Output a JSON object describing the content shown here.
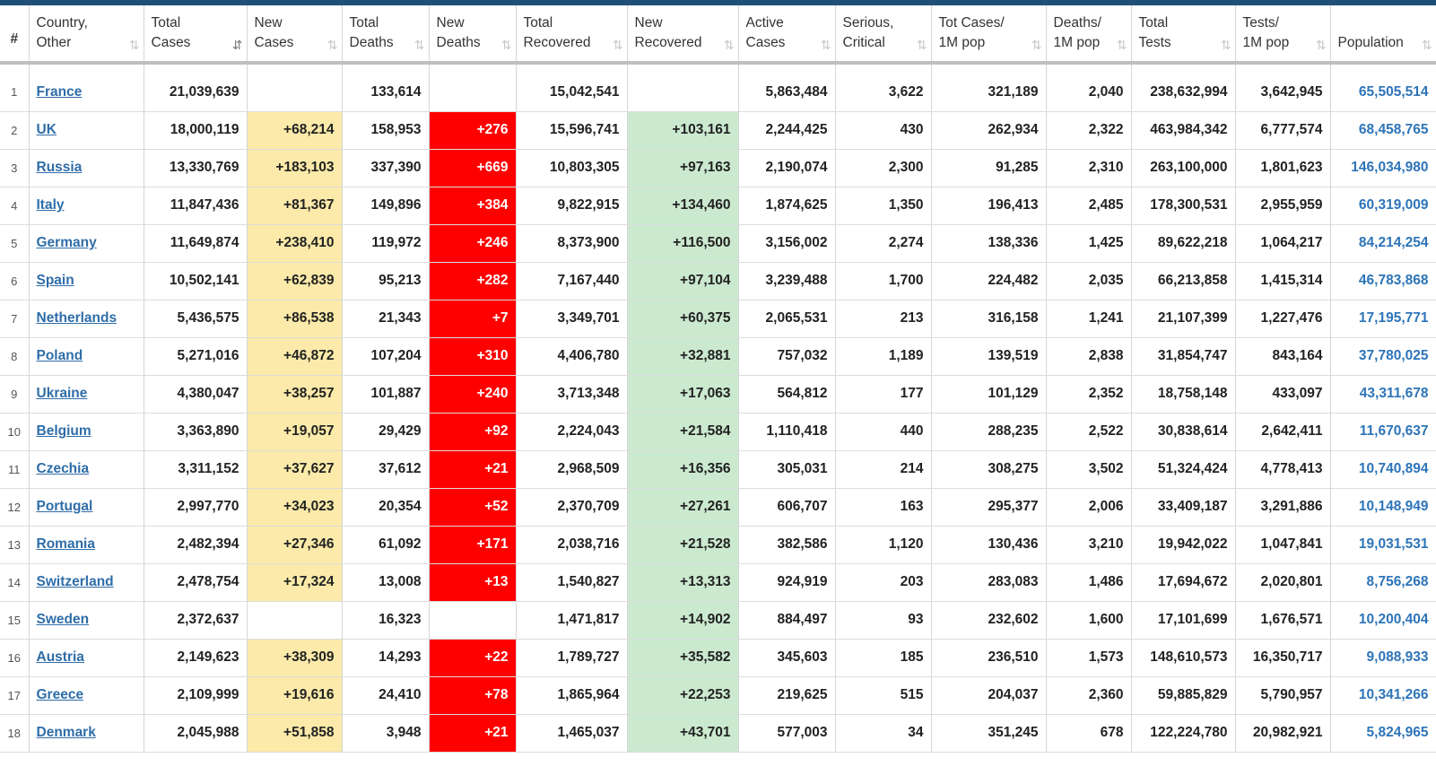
{
  "headers": [
    {
      "l1": "#",
      "l2": ""
    },
    {
      "l1": "Country,",
      "l2": "Other"
    },
    {
      "l1": "Total",
      "l2": "Cases"
    },
    {
      "l1": "New",
      "l2": "Cases"
    },
    {
      "l1": "Total",
      "l2": "Deaths"
    },
    {
      "l1": "New",
      "l2": "Deaths"
    },
    {
      "l1": "Total",
      "l2": "Recovered"
    },
    {
      "l1": "New",
      "l2": "Recovered"
    },
    {
      "l1": "Active",
      "l2": "Cases"
    },
    {
      "l1": "Serious,",
      "l2": "Critical"
    },
    {
      "l1": "Tot Cases/",
      "l2": "1M pop"
    },
    {
      "l1": "Deaths/",
      "l2": "1M pop"
    },
    {
      "l1": "Total",
      "l2": "Tests"
    },
    {
      "l1": "Tests/",
      "l2": "1M pop"
    },
    {
      "l1": "",
      "l2": "Population"
    }
  ],
  "sort_icon": "⇅",
  "active_sort_icon": "⇵",
  "colors": {
    "new_cases_bg": "#fbeaa9",
    "new_deaths_bg": "#ff0000",
    "new_recovered_bg": "#cbe9cf",
    "link": "#2f6da8",
    "population": "#2d74b8",
    "topbar": "#1f4e79"
  },
  "rows": [
    [
      "1",
      "France",
      "21,039,639",
      "",
      "133,614",
      "",
      "15,042,541",
      "",
      "5,863,484",
      "3,622",
      "321,189",
      "2,040",
      "238,632,994",
      "3,642,945",
      "65,505,514"
    ],
    [
      "2",
      "UK",
      "18,000,119",
      "+68,214",
      "158,953",
      "+276",
      "15,596,741",
      "+103,161",
      "2,244,425",
      "430",
      "262,934",
      "2,322",
      "463,984,342",
      "6,777,574",
      "68,458,765"
    ],
    [
      "3",
      "Russia",
      "13,330,769",
      "+183,103",
      "337,390",
      "+669",
      "10,803,305",
      "+97,163",
      "2,190,074",
      "2,300",
      "91,285",
      "2,310",
      "263,100,000",
      "1,801,623",
      "146,034,980"
    ],
    [
      "4",
      "Italy",
      "11,847,436",
      "+81,367",
      "149,896",
      "+384",
      "9,822,915",
      "+134,460",
      "1,874,625",
      "1,350",
      "196,413",
      "2,485",
      "178,300,531",
      "2,955,959",
      "60,319,009"
    ],
    [
      "5",
      "Germany",
      "11,649,874",
      "+238,410",
      "119,972",
      "+246",
      "8,373,900",
      "+116,500",
      "3,156,002",
      "2,274",
      "138,336",
      "1,425",
      "89,622,218",
      "1,064,217",
      "84,214,254"
    ],
    [
      "6",
      "Spain",
      "10,502,141",
      "+62,839",
      "95,213",
      "+282",
      "7,167,440",
      "+97,104",
      "3,239,488",
      "1,700",
      "224,482",
      "2,035",
      "66,213,858",
      "1,415,314",
      "46,783,868"
    ],
    [
      "7",
      "Netherlands",
      "5,436,575",
      "+86,538",
      "21,343",
      "+7",
      "3,349,701",
      "+60,375",
      "2,065,531",
      "213",
      "316,158",
      "1,241",
      "21,107,399",
      "1,227,476",
      "17,195,771"
    ],
    [
      "8",
      "Poland",
      "5,271,016",
      "+46,872",
      "107,204",
      "+310",
      "4,406,780",
      "+32,881",
      "757,032",
      "1,189",
      "139,519",
      "2,838",
      "31,854,747",
      "843,164",
      "37,780,025"
    ],
    [
      "9",
      "Ukraine",
      "4,380,047",
      "+38,257",
      "101,887",
      "+240",
      "3,713,348",
      "+17,063",
      "564,812",
      "177",
      "101,129",
      "2,352",
      "18,758,148",
      "433,097",
      "43,311,678"
    ],
    [
      "10",
      "Belgium",
      "3,363,890",
      "+19,057",
      "29,429",
      "+92",
      "2,224,043",
      "+21,584",
      "1,110,418",
      "440",
      "288,235",
      "2,522",
      "30,838,614",
      "2,642,411",
      "11,670,637"
    ],
    [
      "11",
      "Czechia",
      "3,311,152",
      "+37,627",
      "37,612",
      "+21",
      "2,968,509",
      "+16,356",
      "305,031",
      "214",
      "308,275",
      "3,502",
      "51,324,424",
      "4,778,413",
      "10,740,894"
    ],
    [
      "12",
      "Portugal",
      "2,997,770",
      "+34,023",
      "20,354",
      "+52",
      "2,370,709",
      "+27,261",
      "606,707",
      "163",
      "295,377",
      "2,006",
      "33,409,187",
      "3,291,886",
      "10,148,949"
    ],
    [
      "13",
      "Romania",
      "2,482,394",
      "+27,346",
      "61,092",
      "+171",
      "2,038,716",
      "+21,528",
      "382,586",
      "1,120",
      "130,436",
      "3,210",
      "19,942,022",
      "1,047,841",
      "19,031,531"
    ],
    [
      "14",
      "Switzerland",
      "2,478,754",
      "+17,324",
      "13,008",
      "+13",
      "1,540,827",
      "+13,313",
      "924,919",
      "203",
      "283,083",
      "1,486",
      "17,694,672",
      "2,020,801",
      "8,756,268"
    ],
    [
      "15",
      "Sweden",
      "2,372,637",
      "",
      "16,323",
      "",
      "1,471,817",
      "+14,902",
      "884,497",
      "93",
      "232,602",
      "1,600",
      "17,101,699",
      "1,676,571",
      "10,200,404"
    ],
    [
      "16",
      "Austria",
      "2,149,623",
      "+38,309",
      "14,293",
      "+22",
      "1,789,727",
      "+35,582",
      "345,603",
      "185",
      "236,510",
      "1,573",
      "148,610,573",
      "16,350,717",
      "9,088,933"
    ],
    [
      "17",
      "Greece",
      "2,109,999",
      "+19,616",
      "24,410",
      "+78",
      "1,865,964",
      "+22,253",
      "219,625",
      "515",
      "204,037",
      "2,360",
      "59,885,829",
      "5,790,957",
      "10,341,266"
    ],
    [
      "18",
      "Denmark",
      "2,045,988",
      "+51,858",
      "3,948",
      "+21",
      "1,465,037",
      "+43,701",
      "577,003",
      "34",
      "351,245",
      "678",
      "122,224,780",
      "20,982,921",
      "5,824,965"
    ]
  ]
}
